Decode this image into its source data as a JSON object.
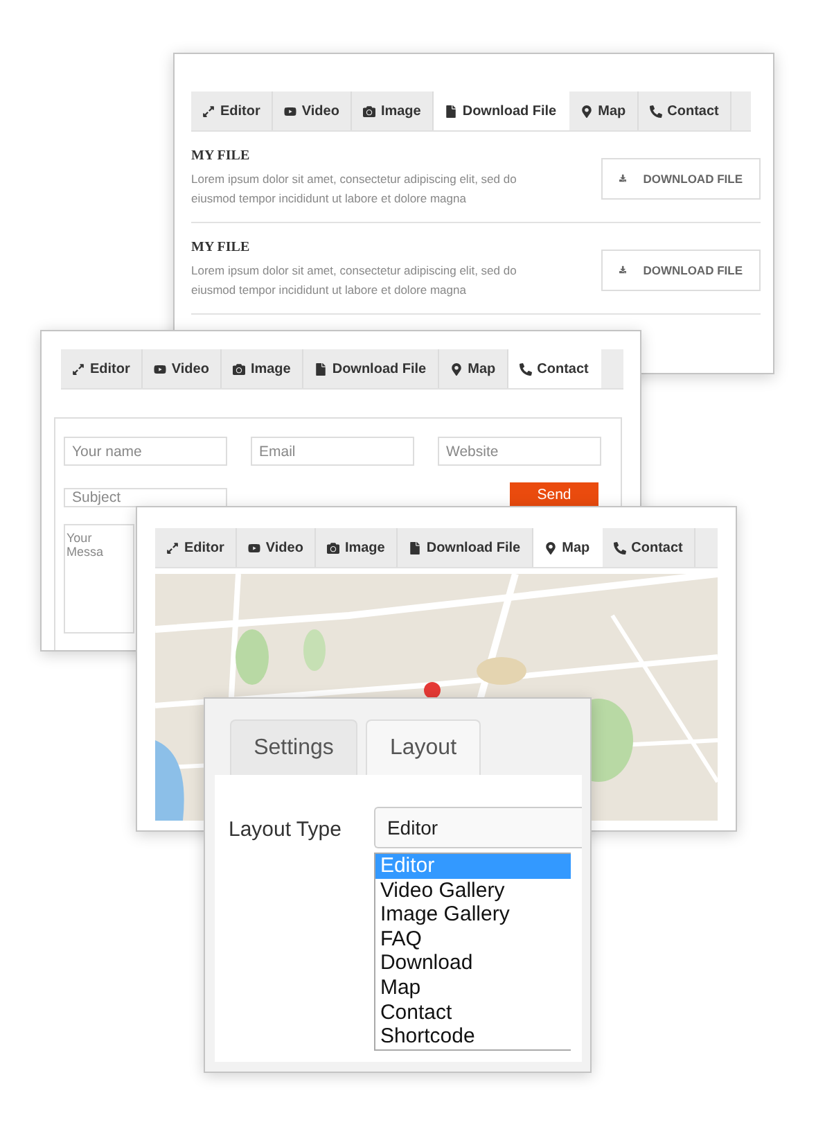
{
  "download_window": {
    "tabs": [
      {
        "label": "Editor",
        "selected": false
      },
      {
        "label": "Video",
        "selected": false
      },
      {
        "label": "Image",
        "selected": false
      },
      {
        "label": "Download File",
        "selected": true
      },
      {
        "label": "Map",
        "selected": false
      },
      {
        "label": "Contact",
        "selected": false
      }
    ],
    "files": [
      {
        "title": "MY FILE",
        "description": "Lorem ipsum dolor sit amet, consectetur adipiscing elit, sed do eiusmod tempor incididunt ut labore et dolore magna",
        "button": "DOWNLOAD FILE"
      },
      {
        "title": "MY FILE",
        "description": "Lorem ipsum dolor sit amet, consectetur adipiscing elit, sed do eiusmod tempor incididunt ut labore et dolore magna",
        "button": "DOWNLOAD FILE"
      }
    ]
  },
  "contact_window": {
    "tabs": [
      {
        "label": "Editor",
        "selected": false
      },
      {
        "label": "Video",
        "selected": false
      },
      {
        "label": "Image",
        "selected": false
      },
      {
        "label": "Download File",
        "selected": false
      },
      {
        "label": "Map",
        "selected": false
      },
      {
        "label": "Contact",
        "selected": true
      }
    ],
    "fields": [
      {
        "placeholder": "Your name"
      },
      {
        "placeholder": "Email"
      },
      {
        "placeholder": "Website"
      }
    ],
    "subject": {
      "placeholder": "Subject"
    },
    "send": "Send",
    "message": {
      "placeholder": "Your Messa"
    }
  },
  "map_window": {
    "tabs": [
      {
        "label": "Editor",
        "selected": false
      },
      {
        "label": "Video",
        "selected": false
      },
      {
        "label": "Image",
        "selected": false
      },
      {
        "label": "Download File",
        "selected": false
      },
      {
        "label": "Map",
        "selected": true
      },
      {
        "label": "Contact",
        "selected": false
      }
    ]
  },
  "layout_window": {
    "tabs": [
      {
        "label": "Settings",
        "selected": false
      },
      {
        "label": "Layout",
        "selected": true
      }
    ],
    "field_label": "Layout Type",
    "select": {
      "value": "Editor"
    },
    "options": [
      {
        "label": "Editor",
        "selected": true
      },
      {
        "label": "Video Gallery",
        "selected": false
      },
      {
        "label": "Image Gallery",
        "selected": false
      },
      {
        "label": "FAQ",
        "selected": false
      },
      {
        "label": "Download",
        "selected": false
      },
      {
        "label": "Map",
        "selected": false
      },
      {
        "label": "Contact",
        "selected": false
      },
      {
        "label": "Shortcode",
        "selected": false
      }
    ]
  }
}
